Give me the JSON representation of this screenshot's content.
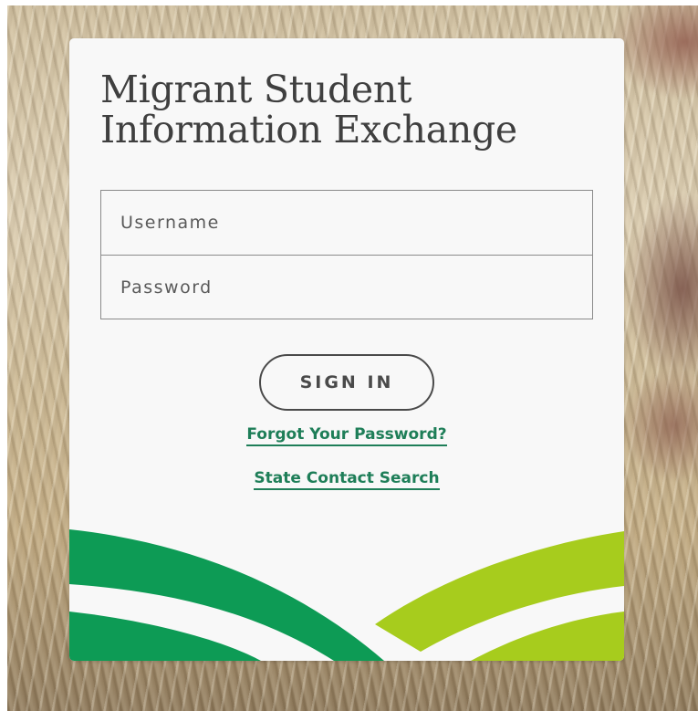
{
  "login": {
    "title_line1": "Migrant Student",
    "title_line2": "Information Exchange",
    "username_placeholder": "Username",
    "password_placeholder": "Password",
    "sign_in_label": "SIGN IN",
    "forgot_password_link": "Forgot Your Password?",
    "state_contact_link": "State Contact Search"
  },
  "theme": {
    "primary_green": "#0d9b55",
    "lime_green": "#a7cc1d",
    "link_green": "#1e7e58",
    "card_background": "#f8f8f8",
    "title_color": "#3f3f3f"
  }
}
